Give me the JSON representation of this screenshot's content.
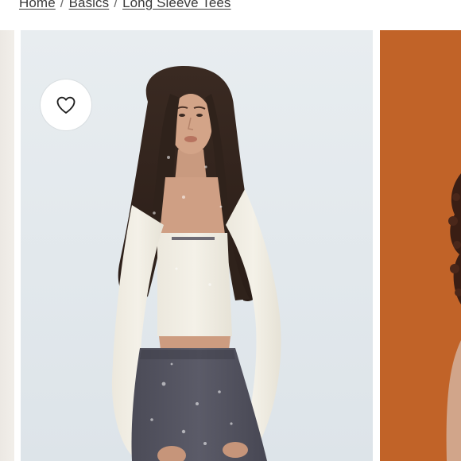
{
  "breadcrumb": {
    "items": [
      {
        "label": "Home"
      },
      {
        "label": "Basics"
      },
      {
        "label": "Long Sleeve Tees"
      }
    ],
    "separator": "/"
  },
  "gallery": {
    "wishlist_icon": "heart-outline-icon",
    "slides": [
      {
        "description_key": "previous-slide"
      },
      {
        "description_key": "main-product-photo"
      },
      {
        "description_key": "next-slide"
      }
    ]
  },
  "colors": {
    "text": "#3a3a3a",
    "next_slide_bg": "#c46429",
    "main_slide_bg": "#e3e9ed"
  }
}
